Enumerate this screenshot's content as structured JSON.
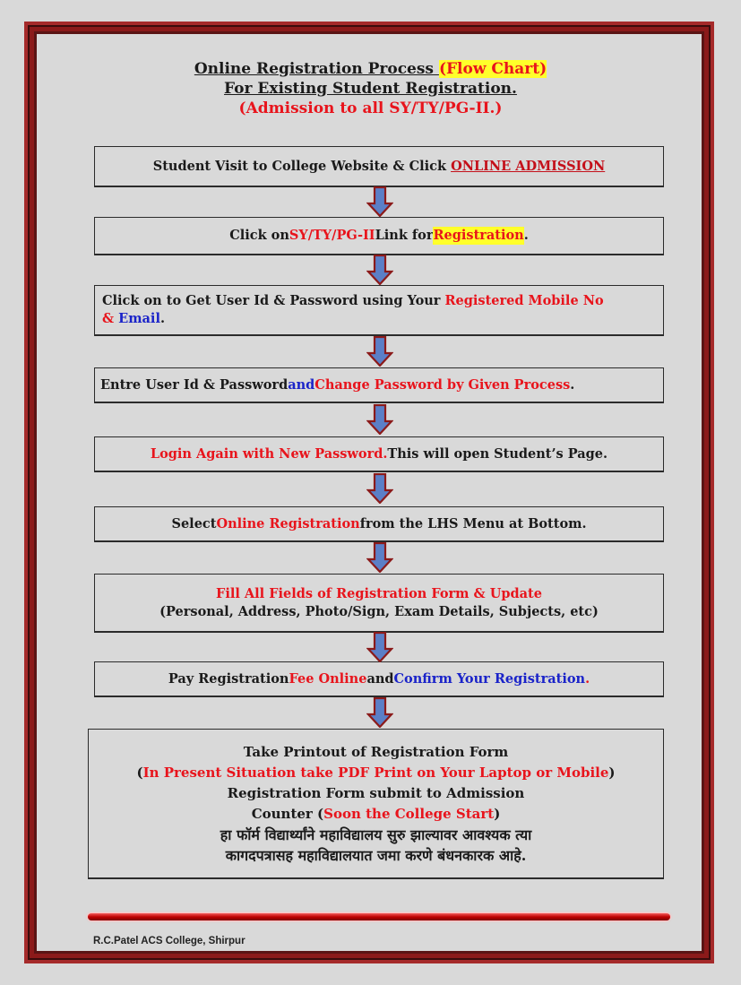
{
  "title": {
    "line1_part1": "Online Registration Process ",
    "line1_part2": "(Flow Chart)",
    "line2": "For Existing Student Registration.",
    "line3": "(Admission to all SY/TY/PG-II.)"
  },
  "steps": {
    "s1": {
      "text": "Student Visit to College Website & Click ",
      "link": "ONLINE ADMISSION"
    },
    "s2": {
      "a": "Click on ",
      "b": "SY/TY/PG-II",
      "c": " Link for ",
      "d": "Registration",
      "e": "."
    },
    "s3": {
      "a": "Click on to Get User Id & Password using Your ",
      "b": "Registered Mobile No",
      "c": "&",
      "d": " Email",
      "e": "."
    },
    "s4": {
      "a": "Entre User Id & Password ",
      "b": "and",
      "c": " Change Password by Given Process",
      "d": "."
    },
    "s5": {
      "a": "Login Again with New Password.",
      "b": " This will open Student’s Page."
    },
    "s6": {
      "a": "Select ",
      "b": "Online Registration",
      "c": " from the LHS Menu at Bottom."
    },
    "s7": {
      "a": "Fill All Fields of Registration Form & Update",
      "b": "(Personal, Address, Photo/Sign, Exam Details, Subjects, etc)"
    },
    "s8": {
      "a": "Pay Registration ",
      "b": "Fee Online",
      "c": " and ",
      "d": "Confirm Your Registration",
      "e": "."
    },
    "s9": {
      "a": "Take Printout of Registration Form",
      "b1": "(",
      "b2": "In Present Situation take PDF Print on Your Laptop or Mobile",
      "b3": ")",
      "c": "Registration Form submit to Admission",
      "d1": "Counter (",
      "d2": "Soon the College Start",
      "d3": ")",
      "e": "हा फॉर्म विद्यार्थ्यांने महाविद्यालय सुरु झाल्यावर आवश्यक त्या",
      "f": "कागदपत्रासह महाविद्यालयात जमा करणे बंधनकारक आहे."
    }
  },
  "footer": "R.C.Patel ACS College, Shirpur",
  "colors": {
    "red": "#e8141c",
    "blue": "#1a23c9",
    "highlight": "#ffff2a",
    "frame": "#8b1a1a",
    "arrow": "#5b7fc7"
  }
}
